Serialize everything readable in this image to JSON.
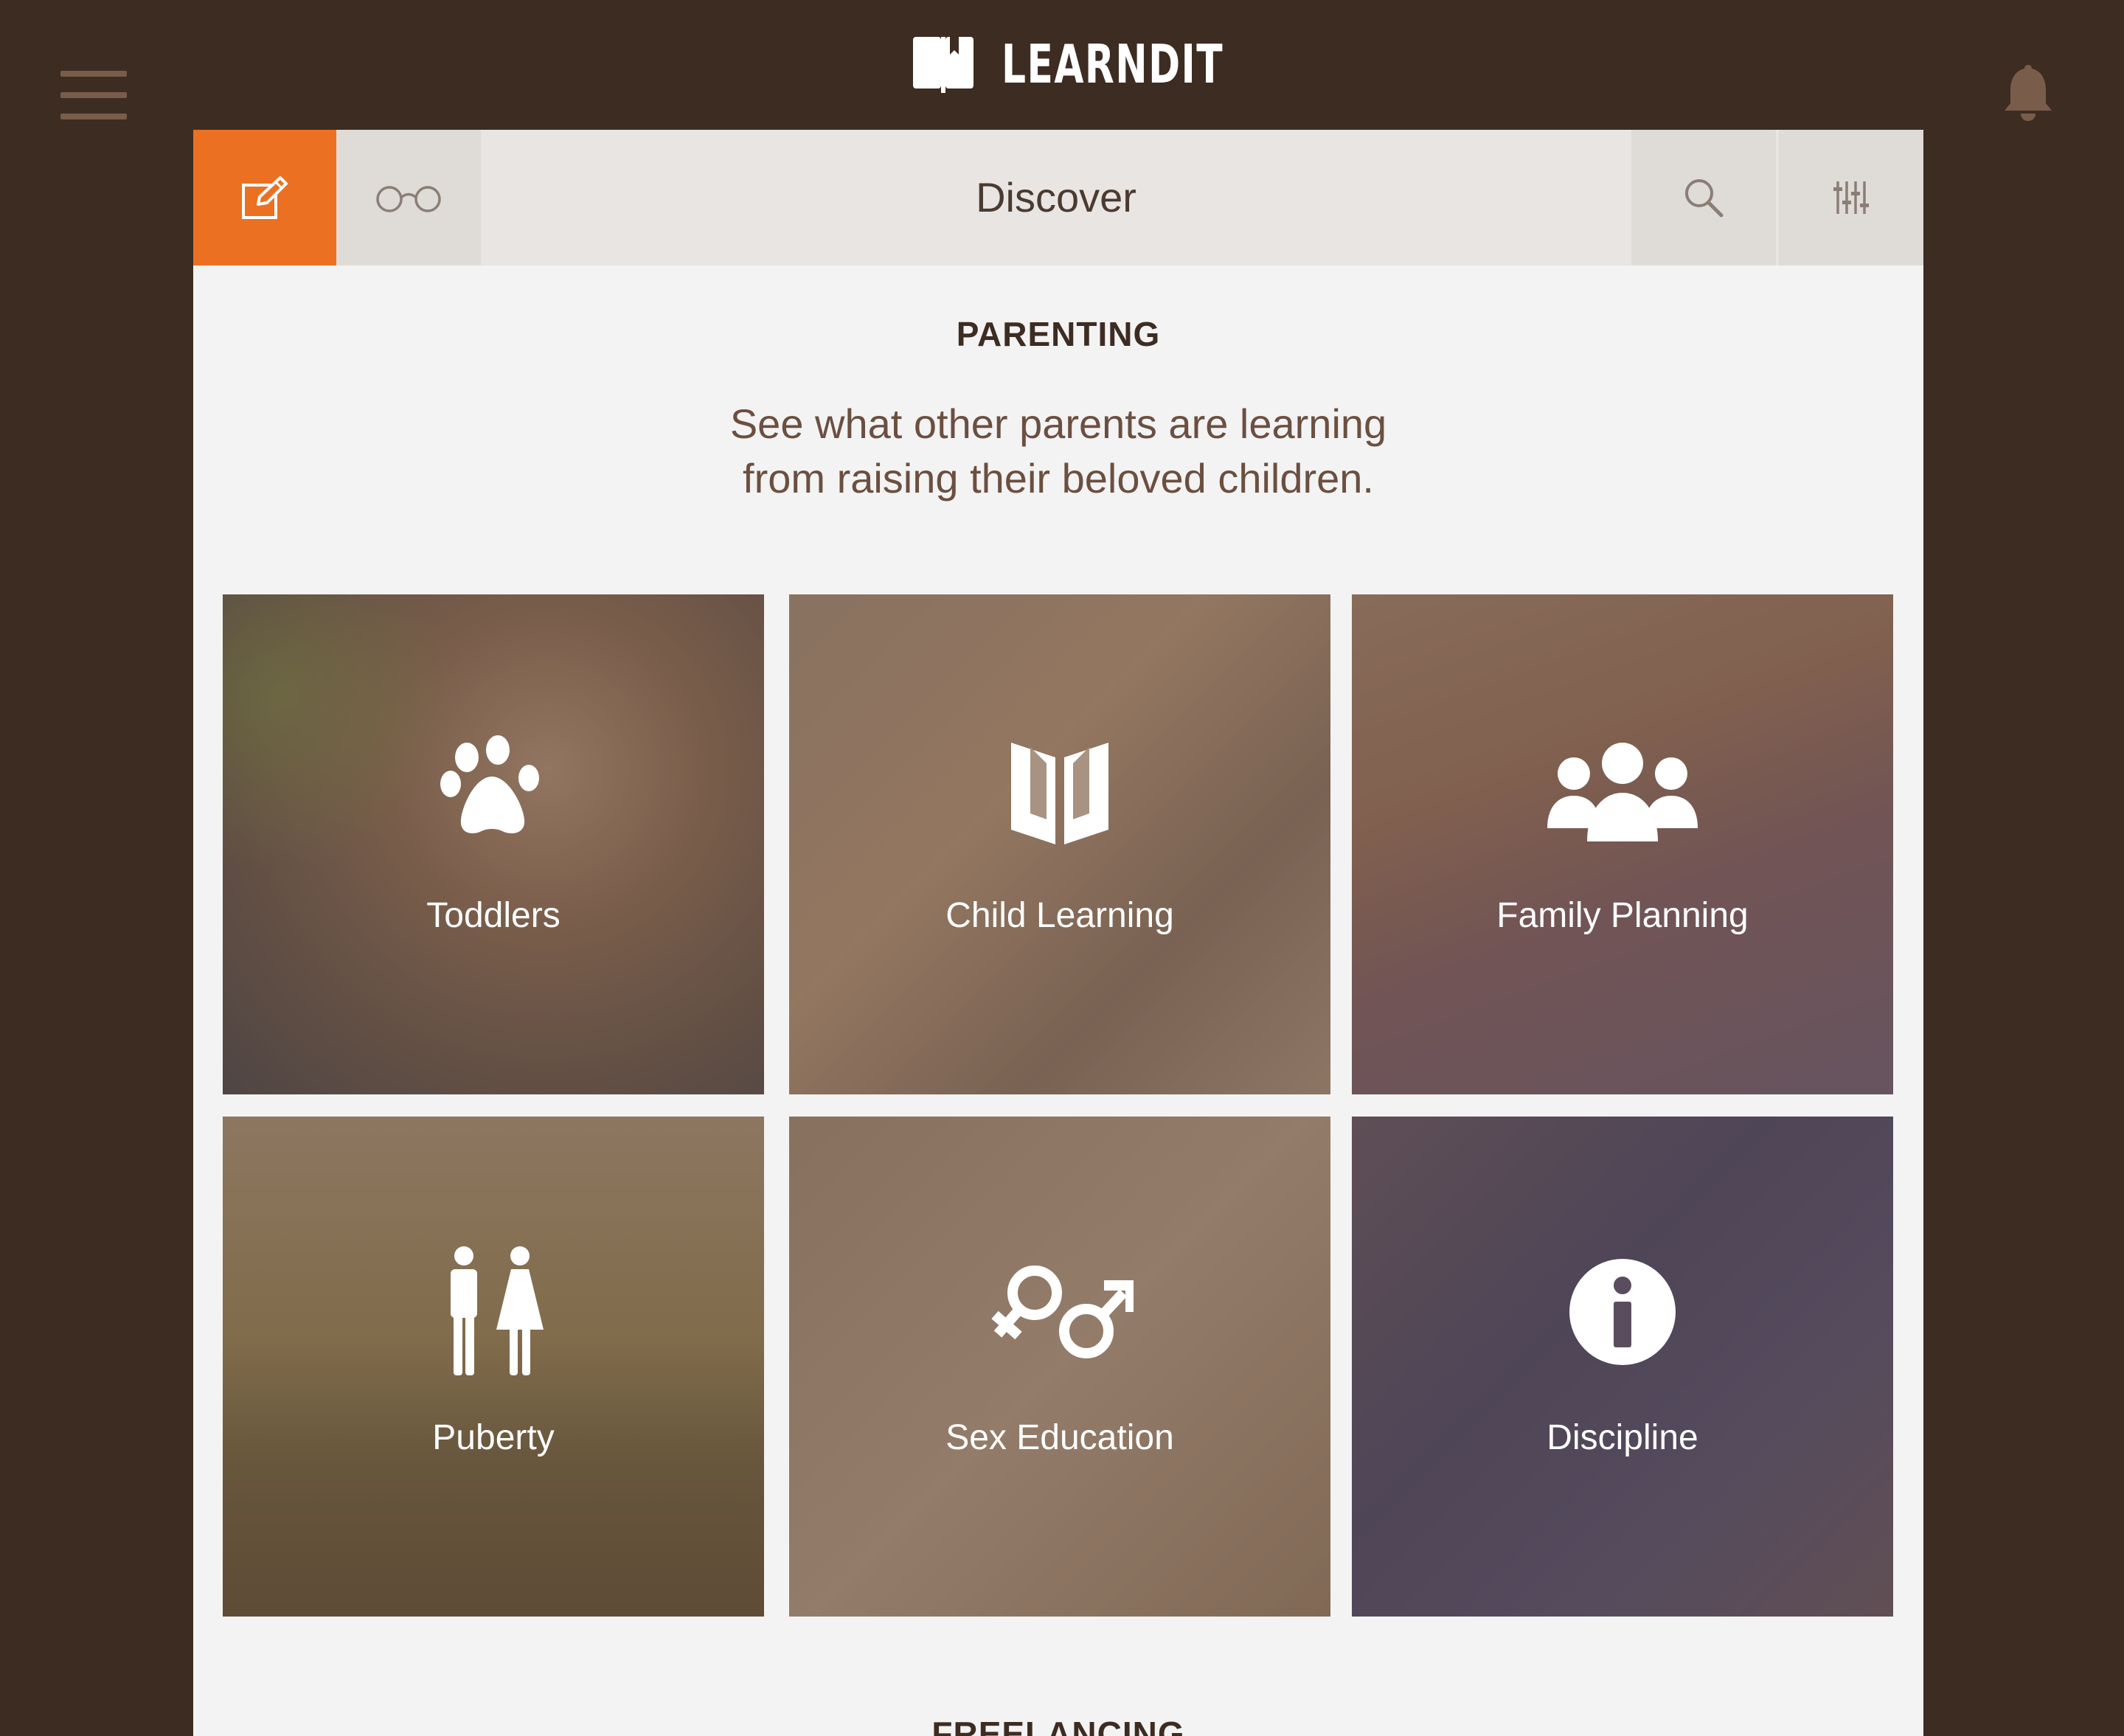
{
  "app": {
    "name": "LEARNDIT"
  },
  "toolbar": {
    "title": "Discover"
  },
  "section": {
    "heading": "PARENTING",
    "subtitle_line1": "See what other parents are learning",
    "subtitle_line2": "from raising their beloved children."
  },
  "tiles": [
    {
      "label": "Toddlers",
      "icon": "paw-icon"
    },
    {
      "label": "Child Learning",
      "icon": "book-icon"
    },
    {
      "label": "Family Planning",
      "icon": "people-icon"
    },
    {
      "label": "Puberty",
      "icon": "man-woman-icon"
    },
    {
      "label": "Sex Education",
      "icon": "gender-symbols-icon"
    },
    {
      "label": "Discipline",
      "icon": "info-icon"
    }
  ],
  "next_section": {
    "heading": "FREELANCING"
  },
  "colors": {
    "background": "#3d2c22",
    "accent": "#ec7022",
    "panel": "#f3f3f3",
    "toolbar": "#e8e5e2"
  }
}
